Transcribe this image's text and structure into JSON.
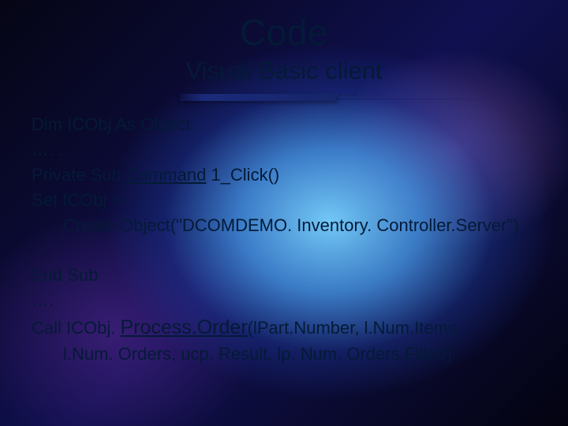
{
  "title": "Code",
  "subtitle": "Visual Basic client",
  "code": {
    "l1": "Dim ICObj As Object",
    "l2": "…. .",
    "l3_a": "Private Sub ",
    "l3_b": "Command",
    "l3_c": " 1_Click()",
    "l4": "Set ICObj =",
    "l5": "Create.Object(\"DCOMDEMO. Inventory. Controller.Server\")",
    "l6": ". . .",
    "l7": "End Sub",
    "l8": "….",
    "l9_a": "Call ICObj. ",
    "l9_b": "Process.Order",
    "l9_c": "(lPart.Number, l.Num.Items,",
    "l10": "l.Num. Orders, ucp. Result, lp. Num. Orders.Filled)"
  }
}
